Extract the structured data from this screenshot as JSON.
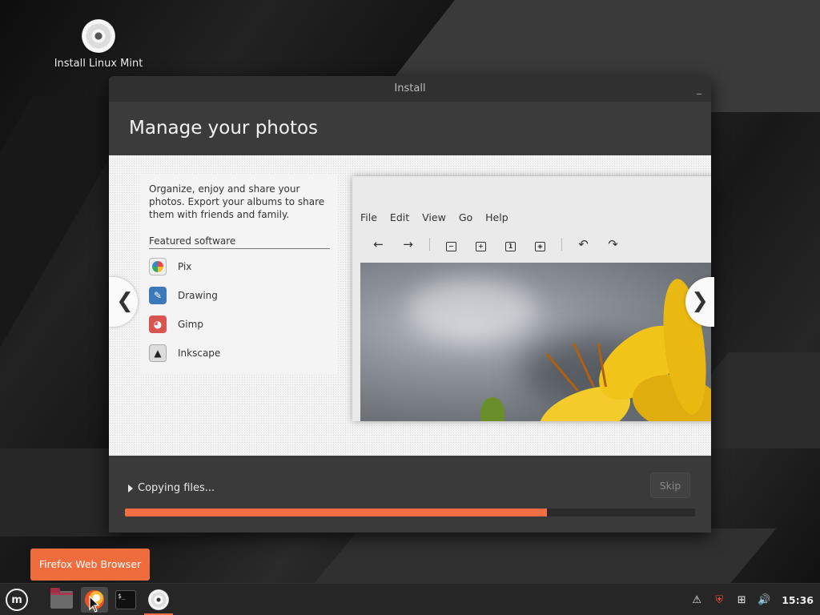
{
  "desktop": {
    "icon_label": "Install Linux Mint",
    "icon": "disc-icon"
  },
  "window": {
    "title": "Install",
    "minimize_symbol": "_",
    "header_title": "Manage your photos"
  },
  "slide": {
    "description": "Organize, enjoy and share your photos. Export your albums to share them with friends and family.",
    "featured_title": "Featured software",
    "apps": [
      {
        "name": "Pix",
        "icon": "pix-icon"
      },
      {
        "name": "Drawing",
        "icon": "drawing-icon"
      },
      {
        "name": "Gimp",
        "icon": "gimp-icon"
      },
      {
        "name": "Inkscape",
        "icon": "inkscape-icon"
      }
    ],
    "screenshot_menu": [
      "File",
      "Edit",
      "View",
      "Go",
      "Help"
    ],
    "prev_symbol": "❮",
    "next_symbol": "❯"
  },
  "footer": {
    "status": "Copying files...",
    "skip_label": "Skip",
    "progress": 0.74
  },
  "tooltip": "Firefox Web Browser",
  "taskbar": {
    "apps": [
      "menu-icon",
      "files-icon",
      "firefox-icon",
      "terminal-icon",
      "disc-icon"
    ],
    "terminal_glyph": "$_",
    "clock": "15:36"
  },
  "colors": {
    "accent": "#f46d43",
    "tooltip": "#ef6c3d"
  }
}
